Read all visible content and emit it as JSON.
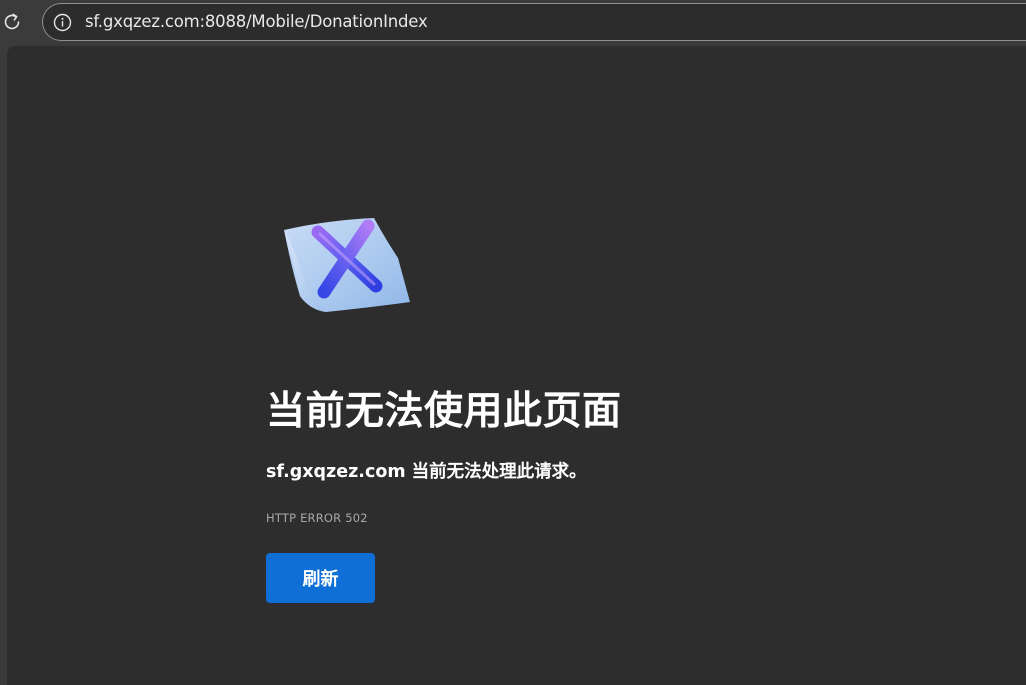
{
  "browser": {
    "url": "sf.gxqzez.com:8088/Mobile/DonationIndex"
  },
  "error_page": {
    "title": "当前无法使用此页面",
    "description": "sf.gxqzez.com 当前无法处理此请求。",
    "error_code": "HTTP ERROR 502",
    "refresh_label": "刷新"
  },
  "icons": {
    "reload": "reload-icon",
    "info": "info-icon",
    "error": "error-page-icon"
  },
  "colors": {
    "page_bg": "#2d2d2d",
    "chrome_bg": "#3b3b3b",
    "button_bg": "#0f6fd6",
    "text_primary": "#ffffff",
    "text_secondary": "#a8a8a8"
  }
}
